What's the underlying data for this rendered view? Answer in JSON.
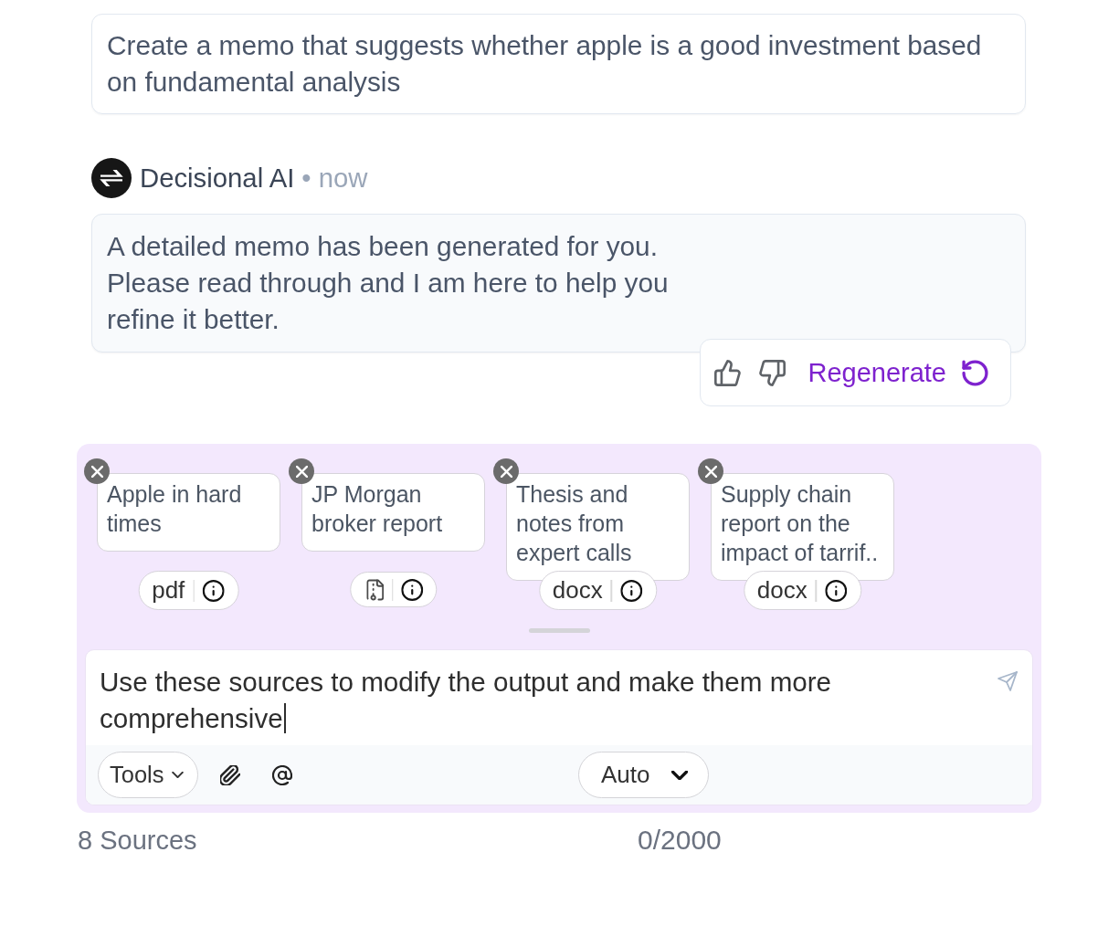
{
  "user_message": {
    "text": "Create a memo that suggests whether apple is a good investment based on fundamental analysis"
  },
  "assistant_message": {
    "sender": "Decisional AI",
    "time": "• now",
    "text": "A detailed memo has been generated for you. Please read through and I am here to help you refine it better."
  },
  "feedback": {
    "regenerate_label": "Regenerate"
  },
  "sources": [
    {
      "kind": "text",
      "title": "Apple in hard times",
      "format": "pdf"
    },
    {
      "kind": "icon",
      "title": "JP Morgan broker report"
    },
    {
      "kind": "text",
      "title": "Thesis and notes from expert calls",
      "format": "docx"
    },
    {
      "kind": "text",
      "title": "Supply chain report on the impact of tarrif..",
      "format": "docx"
    }
  ],
  "composer": {
    "value": "Use these sources to modify the output and make them more comprehensive",
    "focused": true,
    "tools_label": "Tools",
    "mode": "Auto"
  },
  "footer": {
    "source_count": "8 Sources",
    "char_count": "0/2000"
  }
}
